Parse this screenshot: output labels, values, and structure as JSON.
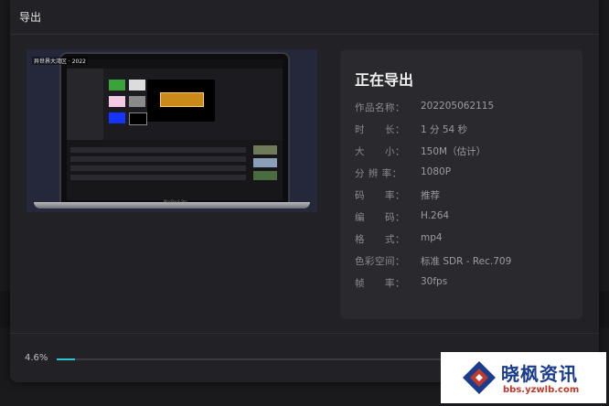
{
  "dialog": {
    "title": "导出"
  },
  "preview": {
    "overlay_text": "异世界大湾区 · 2022",
    "laptop_brand": "MacBook Pro"
  },
  "info": {
    "heading": "正在导出",
    "rows": [
      {
        "label": "作品名称：",
        "value": "202205062115"
      },
      {
        "label": "时　　长：",
        "value": "1 分 54 秒"
      },
      {
        "label": "大　　小：",
        "value": "150M（估计）"
      },
      {
        "label": "分 辨 率：",
        "value": "1080P"
      },
      {
        "label": "码　　率：",
        "value": "推荐"
      },
      {
        "label": "编　　码：",
        "value": "H.264"
      },
      {
        "label": "格　　式：",
        "value": "mp4"
      },
      {
        "label": "色彩空间：",
        "value": "标准 SDR - Rec.709"
      },
      {
        "label": "帧　　率：",
        "value": "30fps"
      }
    ]
  },
  "progress": {
    "text": "4.6%",
    "fraction": 0.046,
    "color": "#2ec5d3"
  },
  "watermark": {
    "title": "晓枫资讯",
    "subtitle": "bbs.yzwlb.com"
  }
}
